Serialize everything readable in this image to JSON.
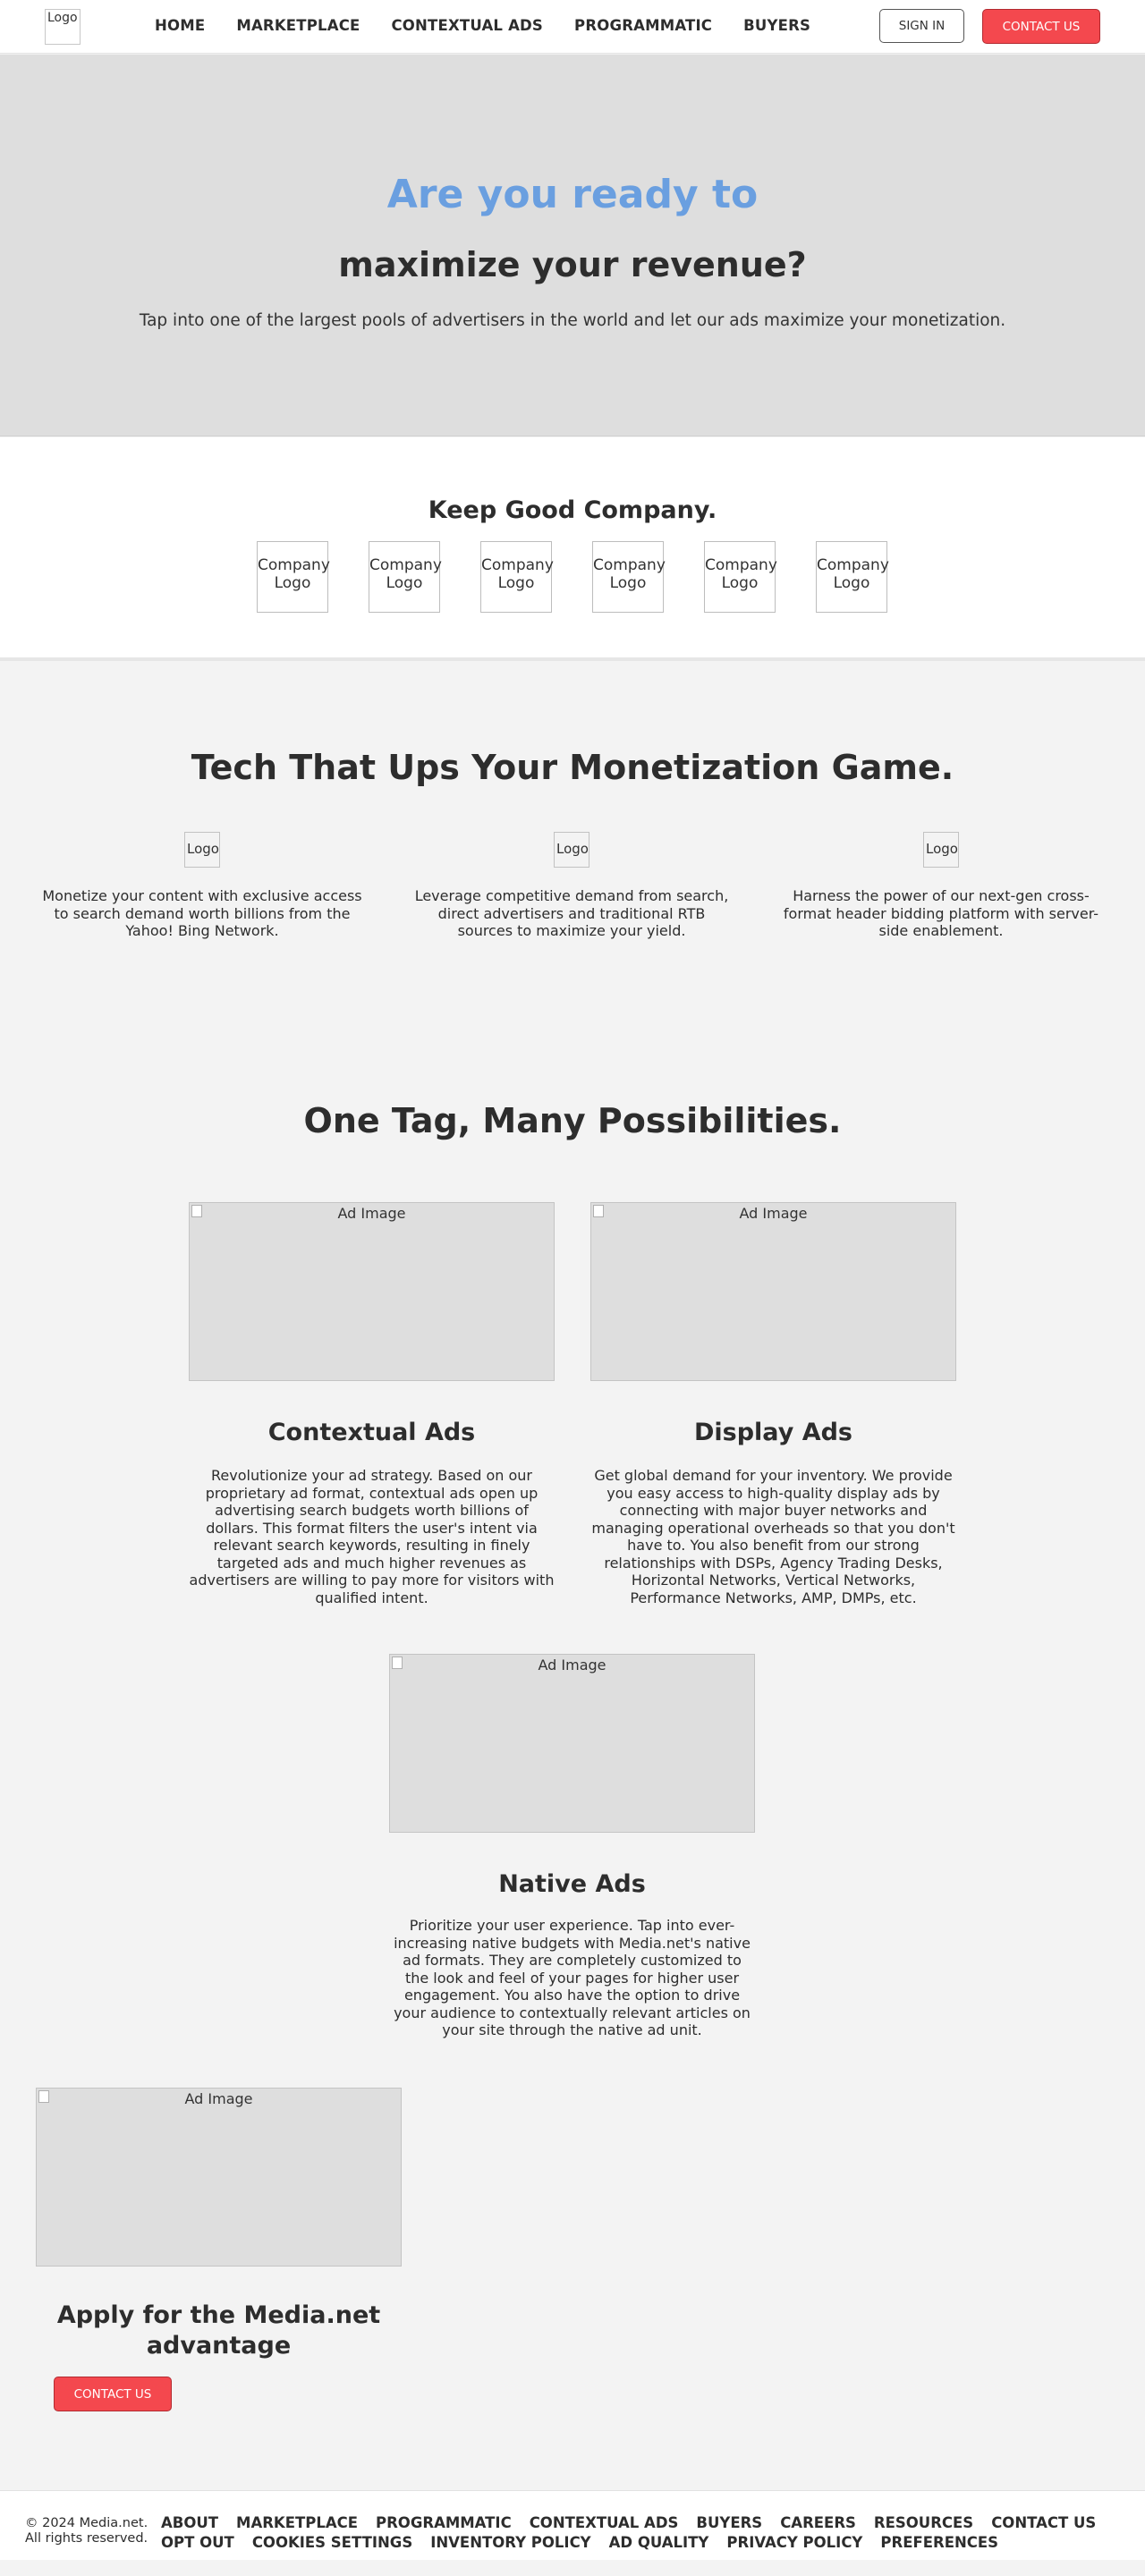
{
  "header": {
    "logo_alt": "Logo",
    "nav": [
      "HOME",
      "MARKETPLACE",
      "CONTEXTUAL ADS",
      "PROGRAMMATIC",
      "BUYERS"
    ],
    "sign_in": "SIGN IN",
    "contact": "CONTACT US"
  },
  "hero": {
    "line1": "Are you ready to",
    "line2": "maximize your revenue?",
    "subtitle": "Tap into one of the largest pools of advertisers in the world and let our ads maximize your monetization."
  },
  "company": {
    "title": "Keep Good Company.",
    "logos": [
      "Company Logo",
      "Company Logo",
      "Company Logo",
      "Company Logo",
      "Company Logo",
      "Company Logo"
    ]
  },
  "tech": {
    "title": "Tech That Ups Your Monetization Game.",
    "features": [
      {
        "logo_alt": "Logo",
        "text": "Monetize your content with exclusive access to search demand worth billions from the Yahoo! Bing Network."
      },
      {
        "logo_alt": "Logo",
        "text": "Leverage competitive demand from search, direct advertisers and traditional RTB sources to maximize your yield."
      },
      {
        "logo_alt": "Logo",
        "text": "Harness the power of our next-gen cross-format header bidding platform with server-side enablement."
      }
    ]
  },
  "one_tag": {
    "title": "One Tag, Many Possibilities.",
    "image_alt": "Ad Image",
    "ads": [
      {
        "title": "Contextual Ads",
        "text": "Revolutionize your ad strategy. Based on our proprietary ad format, contextual ads open up advertising search budgets worth billions of dollars. This format filters the user's intent via relevant search keywords, resulting in finely targeted ads and much higher revenues as advertisers are willing to pay more for visitors with qualified intent."
      },
      {
        "title": "Display Ads",
        "text": "Get global demand for your inventory. We provide you easy access to high-quality display ads by connecting with major buyer networks and managing operational overheads so that you don't have to. You also benefit from our strong relationships with DSPs, Agency Trading Desks, Horizontal Networks, Vertical Networks, Performance Networks, AMP, DMPs, etc."
      },
      {
        "title": "Native Ads",
        "text": "Prioritize your user experience. Tap into ever-increasing native budgets with Media.net's native ad formats. They are completely customized to the look and feel of your pages for higher user engagement. You also have the option to drive your audience to contextually relevant articles on your site through the native ad unit."
      }
    ]
  },
  "apply": {
    "image_alt": "Ad Image",
    "title": "Apply for the Media.net advantage",
    "button": "CONTACT US"
  },
  "footer": {
    "copyright": "© 2024 Media.net.",
    "rights": "All rights reserved.",
    "links_row1": [
      "ABOUT",
      "MARKETPLACE",
      "PROGRAMMATIC",
      "CONTEXTUAL ADS",
      "BUYERS",
      "CAREERS",
      "RESOURCES",
      "CONTACT US"
    ],
    "links_row2": [
      "OPT OUT",
      "COOKIES SETTINGS",
      "INVENTORY POLICY",
      "AD QUALITY",
      "PRIVACY POLICY",
      "PREFERENCES"
    ]
  }
}
